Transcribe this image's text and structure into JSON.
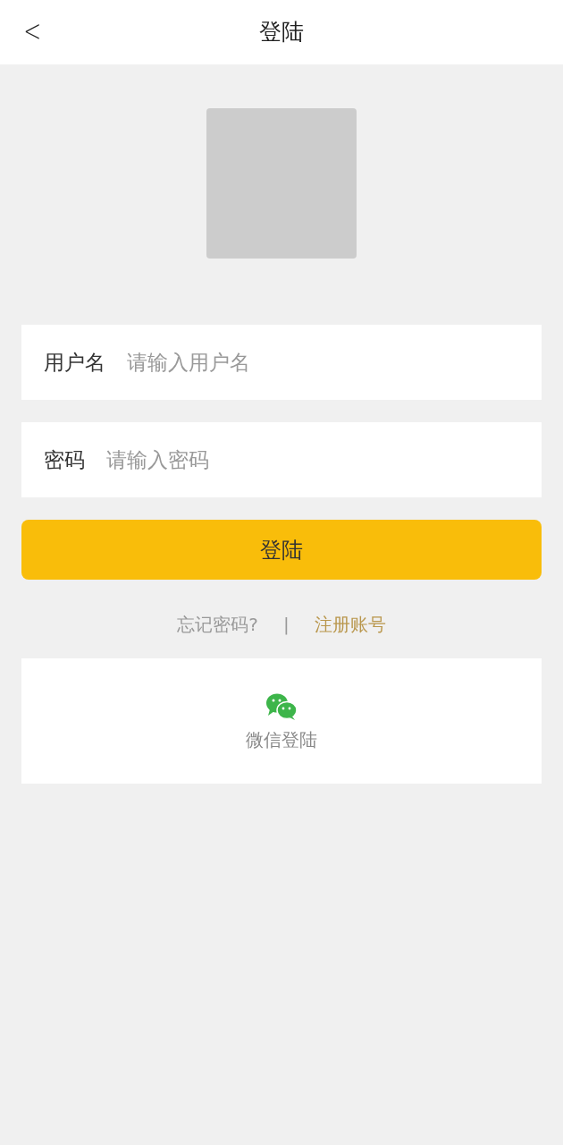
{
  "header": {
    "back": "<",
    "title": "登陆"
  },
  "fields": [
    {
      "label": "用户名",
      "placeholder": "请输入用户名"
    },
    {
      "label": "密码",
      "placeholder": "请输入密码"
    }
  ],
  "login_button": "登陆",
  "links": {
    "forgot": "忘记密码?",
    "separator": "|",
    "register": "注册账号"
  },
  "wechat": {
    "label": "微信登陆"
  }
}
